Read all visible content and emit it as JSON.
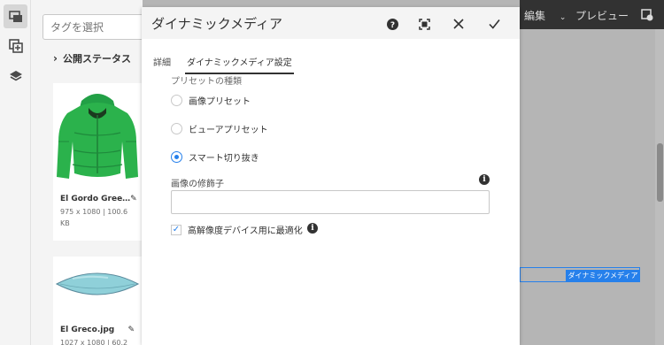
{
  "rail": {
    "icons": [
      "assets-panel-icon",
      "add-asset-icon",
      "layers-icon"
    ]
  },
  "panel": {
    "tag_placeholder": "タグを選択",
    "filter_label": "公開ステータス",
    "cards": [
      {
        "name": "El Gordo Gree…",
        "meta": "975 x 1080 | 100.6 KB",
        "thumb": "green-jacket"
      },
      {
        "name": "El Greco.jpg",
        "meta": "1027 x 1080 | 60.2",
        "thumb": "surfboard"
      }
    ]
  },
  "topbar": {
    "edit_label": "編集",
    "preview_label": "プレビュー"
  },
  "overlay": {
    "dynamic_media_label": "ダイナミックメディア"
  },
  "dialog": {
    "title": "ダイナミックメディア",
    "tabs": [
      "詳細",
      "ダイナミックメディア設定"
    ],
    "selected_tab": 1,
    "preset_type_label": "プリセットの種類",
    "radios": [
      {
        "label": "画像プリセット",
        "checked": false
      },
      {
        "label": "ビューアプリセット",
        "checked": false
      },
      {
        "label": "スマート切り抜き",
        "checked": true
      }
    ],
    "modifier_label": "画像の修飾子",
    "modifier_value": "",
    "hires_label": "高解像度デバイス用に最適化",
    "hires_checked": true
  },
  "colors": {
    "accent": "#2680eb",
    "jacket_green": "#2bb24c",
    "topbar": "#323232"
  }
}
